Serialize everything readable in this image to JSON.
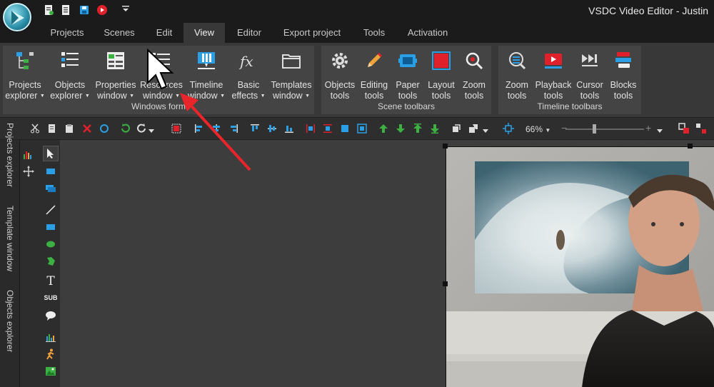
{
  "window": {
    "title": "VSDC Video Editor - Justin"
  },
  "quick_access": [
    "new-project-icon",
    "open-project-icon",
    "save-icon",
    "record-icon",
    "customize-icon"
  ],
  "menu": {
    "tabs": [
      "Projects",
      "Scenes",
      "Edit",
      "View",
      "Editor",
      "Export project",
      "Tools",
      "Activation"
    ],
    "active": "View"
  },
  "ribbon": {
    "groups": [
      {
        "label": "Windows form",
        "buttons": [
          {
            "line1": "Projects",
            "line2": "explorer",
            "dropdown": true,
            "icon": "projects-explorer-icon"
          },
          {
            "line1": "Objects",
            "line2": "explorer",
            "dropdown": true,
            "icon": "objects-explorer-icon"
          },
          {
            "line1": "Properties",
            "line2": "window",
            "dropdown": true,
            "icon": "properties-window-icon"
          },
          {
            "line1": "Resources",
            "line2": "window",
            "dropdown": true,
            "icon": "resources-window-icon"
          },
          {
            "line1": "Timeline",
            "line2": "window",
            "dropdown": true,
            "icon": "timeline-window-icon"
          },
          {
            "line1": "Basic",
            "line2": "effects",
            "dropdown": true,
            "icon": "basic-effects-icon"
          },
          {
            "line1": "Templates",
            "line2": "window",
            "dropdown": true,
            "icon": "templates-window-icon"
          }
        ]
      },
      {
        "label": "Scene toolbars",
        "buttons": [
          {
            "line1": "Objects",
            "line2": "tools",
            "icon": "objects-tools-icon"
          },
          {
            "line1": "Editing",
            "line2": "tools",
            "icon": "editing-tools-icon"
          },
          {
            "line1": "Paper",
            "line2": "tools",
            "icon": "paper-tools-icon"
          },
          {
            "line1": "Layout",
            "line2": "tools",
            "icon": "layout-tools-icon"
          },
          {
            "line1": "Zoom",
            "line2": "tools",
            "icon": "zoom-tools-icon"
          }
        ]
      },
      {
        "label": "Timeline toolbars",
        "buttons": [
          {
            "line1": "Zoom",
            "line2": "tools",
            "icon": "timeline-zoom-icon"
          },
          {
            "line1": "Playback",
            "line2": "tools",
            "icon": "playback-tools-icon"
          },
          {
            "line1": "Cursor",
            "line2": "tools",
            "icon": "cursor-tools-icon"
          },
          {
            "line1": "Blocks",
            "line2": "tools",
            "icon": "blocks-tools-icon"
          }
        ]
      }
    ]
  },
  "toolbar": {
    "zoom_value": "66%",
    "zoom_minus": "−",
    "zoom_plus": "+"
  },
  "side_tabs": [
    "Projects explorer",
    "Template window",
    "Objects explorer"
  ],
  "palette": {
    "text_tool": "T",
    "subtitle_tool": "SUB"
  },
  "colors": {
    "accent_blue": "#2b9fe6",
    "annotation_red": "#e8252a",
    "ribbon_bg": "#444444"
  }
}
